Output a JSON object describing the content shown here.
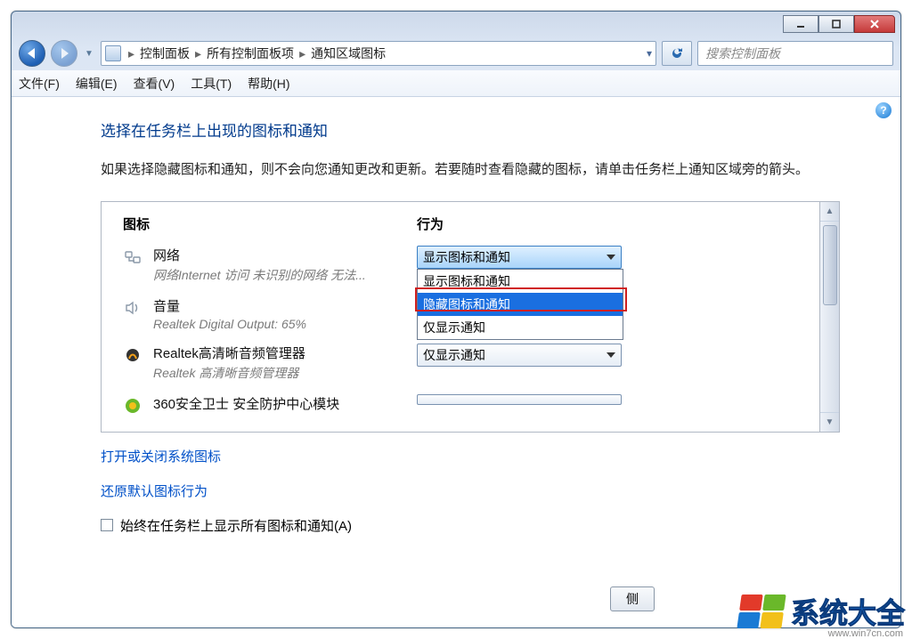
{
  "breadcrumb": {
    "seg1": "控制面板",
    "seg2": "所有控制面板项",
    "seg3": "通知区域图标"
  },
  "search": {
    "placeholder": "搜索控制面板"
  },
  "menu": {
    "file": "文件(F)",
    "edit": "编辑(E)",
    "view": "查看(V)",
    "tools": "工具(T)",
    "help": "帮助(H)"
  },
  "heading": "选择在任务栏上出现的图标和通知",
  "description": "如果选择隐藏图标和通知，则不会向您通知更改和更新。若要随时查看隐藏的图标，请单击任务栏上通知区域旁的箭头。",
  "columns": {
    "icon": "图标",
    "behavior": "行为"
  },
  "rows": [
    {
      "name": "网络",
      "sub": "网络Internet 访问 未识别的网络 无法...",
      "value": "显示图标和通知",
      "icon": "network-icon"
    },
    {
      "name": "音量",
      "sub": "Realtek Digital Output: 65%",
      "value": "",
      "icon": "speaker-icon"
    },
    {
      "name": "Realtek高清晰音频管理器",
      "sub": "Realtek 高清晰音频管理器",
      "value": "仅显示通知",
      "icon": "realtek-icon"
    },
    {
      "name": "360安全卫士 安全防护中心模块",
      "sub": "",
      "value": "",
      "icon": "shield-icon"
    }
  ],
  "dropdown": {
    "opt1": "显示图标和通知",
    "opt2": "隐藏图标和通知",
    "opt3": "仅显示通知"
  },
  "links": {
    "system_icons": "打开或关闭系统图标",
    "restore": "还原默认图标行为"
  },
  "checkbox": "始终在任务栏上显示所有图标和通知(A)",
  "footer_btn": "侧",
  "watermark": {
    "text": "系统大全",
    "url": "www.win7cn.com"
  }
}
